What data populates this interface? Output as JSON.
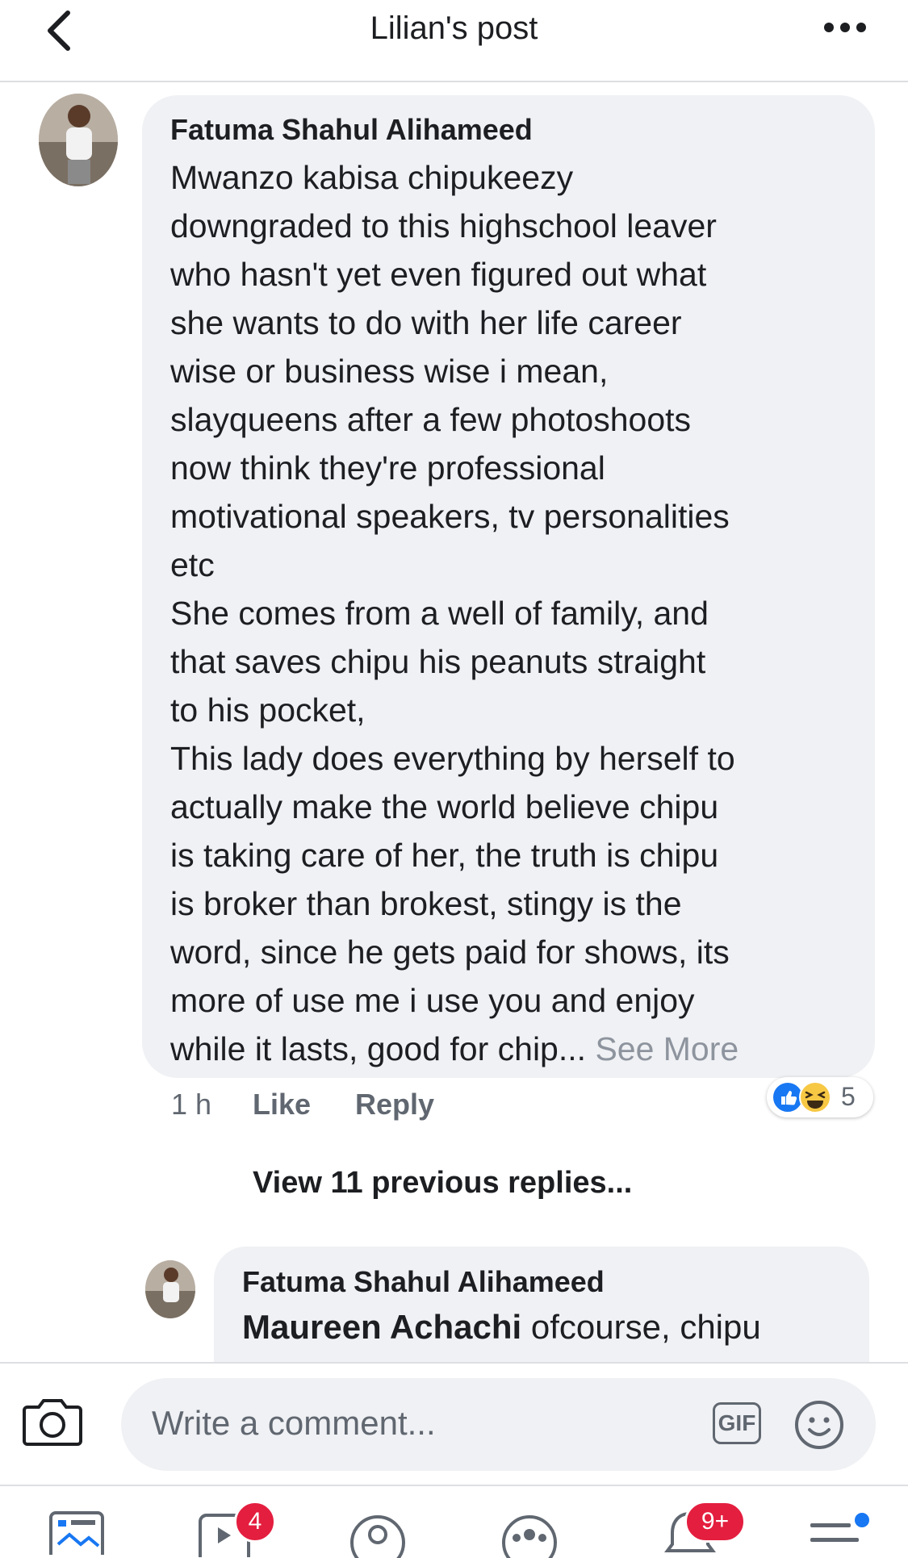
{
  "header": {
    "title": "Lilian's post"
  },
  "comment": {
    "author": "Fatuma Shahul Alihameed",
    "text": "Mwanzo kabisa chipukeezy\ndowngraded to this highschool leaver\nwho hasn't yet even figured out what\nshe wants to do with her life career\nwise or business wise i mean,\nslayqueens after a few photoshoots\nnow think they're professional\nmotivational speakers, tv personalities\netc\nShe comes from a well of family, and\nthat saves chipu his peanuts straight\nto his pocket,\nThis lady does everything by herself to\nactually make the world believe chipu\nis taking care of her, the truth is chipu\nis broker than brokest, stingy is the\nword, since he gets paid for shows, its\nmore of use me i use you and enjoy\nwhile it lasts, good for chip...",
    "see_more": "See More",
    "time": "1 h",
    "like_label": "Like",
    "reply_label": "Reply",
    "reaction_count": "5"
  },
  "view_previous": "View 11 previous replies...",
  "reply": {
    "author": "Fatuma Shahul Alihameed",
    "mention": "Maureen Achachi",
    "text": " ofcourse, chipu"
  },
  "composer": {
    "placeholder": "Write a comment...",
    "gif_label": "GIF"
  },
  "tabs": {
    "video_badge": "4",
    "notifications_badge": "9+"
  },
  "colors": {
    "facebook_blue": "#1877f2",
    "badge_red": "#e41e3f",
    "bubble_gray": "#f0f1f4"
  }
}
